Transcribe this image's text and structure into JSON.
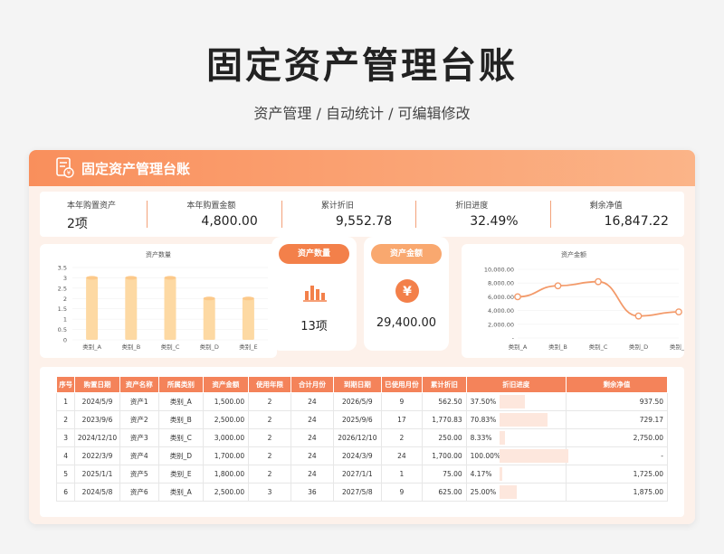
{
  "header": {
    "title": "固定资产管理台账",
    "subtitle": "资产管理 /  自动统计  /  可编辑修改"
  },
  "card": {
    "title": "固定资产管理台账"
  },
  "stats": [
    {
      "label": "本年购置资产",
      "value": "2项"
    },
    {
      "label": "本年购置金额",
      "value": "4,800.00"
    },
    {
      "label": "累计折旧",
      "value": "9,552.78"
    },
    {
      "label": "折旧进度",
      "value": "32.49%"
    },
    {
      "label": "剩余净值",
      "value": "16,847.22"
    }
  ],
  "summary": {
    "qty_label": "资产数量",
    "qty_value": "13项",
    "amt_label": "资产金额",
    "amt_value": "29,400.00"
  },
  "colors": {
    "accent": "#f4835a",
    "bar": "#fdd9a3",
    "line": "#f39a6a"
  },
  "chart_data": [
    {
      "type": "bar",
      "title": "资产数量",
      "categories": [
        "类别_A",
        "类别_B",
        "类别_C",
        "类别_D",
        "类别_E"
      ],
      "values": [
        3,
        3,
        3,
        2,
        2
      ],
      "ylim": [
        0,
        3.5
      ],
      "yticks": [
        "0",
        "0.5",
        "1",
        "1.5",
        "2",
        "2.5",
        "3",
        "3.5"
      ]
    },
    {
      "type": "line",
      "title": "资产金额",
      "categories": [
        "类别_A",
        "类别_B",
        "类别_C",
        "类别_D",
        "类别_E"
      ],
      "values": [
        6000,
        7600,
        8200,
        3200,
        3800
      ],
      "ylim": [
        0,
        10000
      ],
      "yticks": [
        "-",
        "2,000.00",
        "4,000.00",
        "6,000.00",
        "8,000.00",
        "10,000.00"
      ]
    }
  ],
  "table": {
    "headers": [
      "序号",
      "购置日期",
      "资产名称",
      "所属类别",
      "资产金额",
      "使用年限",
      "合计月份",
      "到期日期",
      "已使用月份",
      "累计折旧",
      "折旧进度",
      "剩余净值"
    ],
    "rows": [
      {
        "cells": [
          "1",
          "2024/5/9",
          "资产1",
          "类别_A",
          "1,500.00",
          "2",
          "24",
          "2026/5/9",
          "9",
          "562.50",
          "37.50%",
          "937.50"
        ],
        "progress": 0.375
      },
      {
        "cells": [
          "2",
          "2023/9/6",
          "资产2",
          "类别_B",
          "2,500.00",
          "2",
          "24",
          "2025/9/6",
          "17",
          "1,770.83",
          "70.83%",
          "729.17"
        ],
        "progress": 0.7083
      },
      {
        "cells": [
          "3",
          "2024/12/10",
          "资产3",
          "类别_C",
          "3,000.00",
          "2",
          "24",
          "2026/12/10",
          "2",
          "250.00",
          "8.33%",
          "2,750.00"
        ],
        "progress": 0.0833
      },
      {
        "cells": [
          "4",
          "2022/3/9",
          "资产4",
          "类别_D",
          "1,700.00",
          "2",
          "24",
          "2024/3/9",
          "24",
          "1,700.00",
          "100.00%",
          "-"
        ],
        "progress": 1.0
      },
      {
        "cells": [
          "5",
          "2025/1/1",
          "资产5",
          "类别_E",
          "1,800.00",
          "2",
          "24",
          "2027/1/1",
          "1",
          "75.00",
          "4.17%",
          "1,725.00"
        ],
        "progress": 0.0417
      },
      {
        "cells": [
          "6",
          "2024/5/8",
          "资产6",
          "类别_A",
          "2,500.00",
          "3",
          "36",
          "2027/5/8",
          "9",
          "625.00",
          "25.00%",
          "1,875.00"
        ],
        "progress": 0.25
      }
    ]
  }
}
